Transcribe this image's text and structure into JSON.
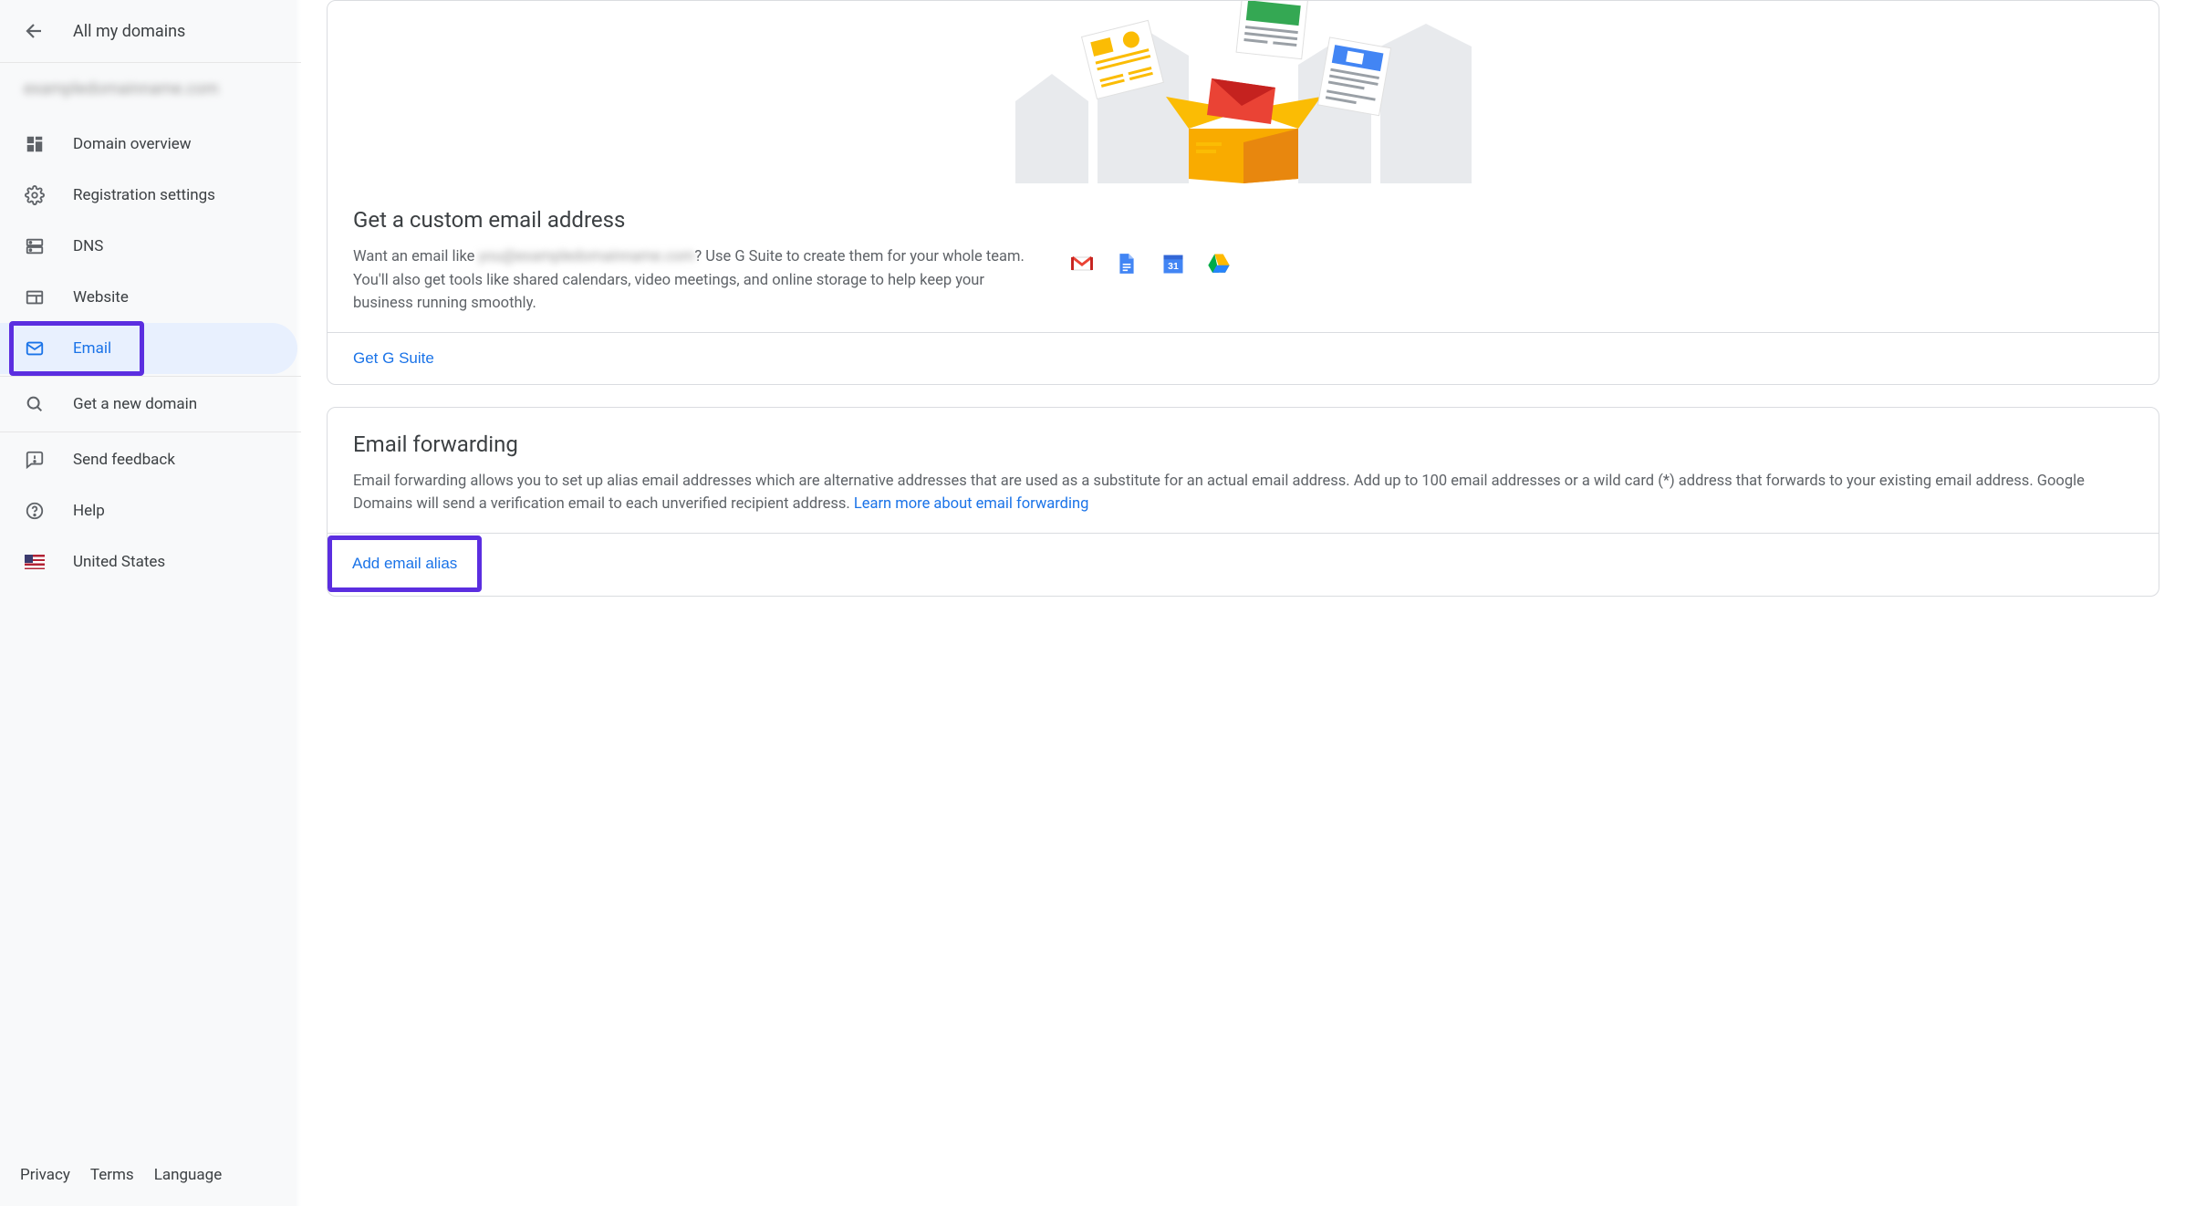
{
  "sidebar": {
    "title": "All my domains",
    "domain_placeholder": "exampledomainname.com",
    "nav": [
      {
        "label": "Domain overview"
      },
      {
        "label": "Registration settings"
      },
      {
        "label": "DNS"
      },
      {
        "label": "Website"
      },
      {
        "label": "Email"
      },
      {
        "label": "Get a new domain"
      },
      {
        "label": "Send feedback"
      },
      {
        "label": "Help"
      },
      {
        "label": "United States"
      }
    ],
    "footer": {
      "privacy": "Privacy",
      "terms": "Terms",
      "language": "Language"
    }
  },
  "gsuite": {
    "title": "Get a custom email address",
    "desc_prefix": "Want an email like ",
    "desc_blur": "you@exampledomainname.com",
    "desc_suffix": "? Use G Suite to create them for your whole team. You'll also get tools like shared calendars, video meetings, and online storage to help keep your business running smoothly.",
    "action": "Get G Suite"
  },
  "forwarding": {
    "title": "Email forwarding",
    "desc": "Email forwarding allows you to set up alias email addresses which are alternative addresses that are used as a substitute for an actual email address. Add up to 100 email addresses or a wild card (*) address that forwards to your existing email address. Google Domains will send a verification email to each unverified recipient address. ",
    "learn_more": "Learn more about email forwarding",
    "action": "Add email alias"
  }
}
